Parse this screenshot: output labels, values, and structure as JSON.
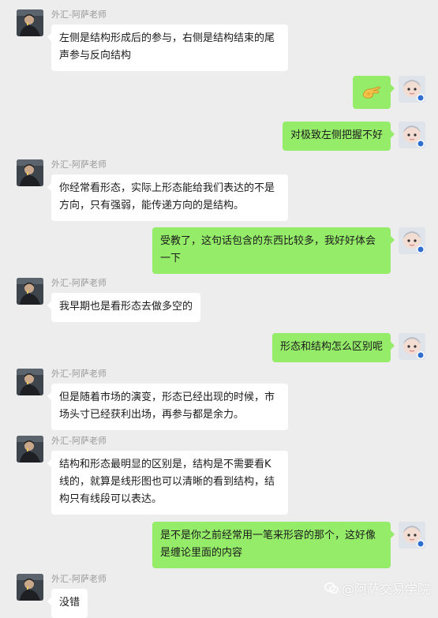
{
  "messages": [
    {
      "id": "m1",
      "side": "left",
      "sender": "外汇-阿萨老师",
      "text": "左侧是结构形成后的参与，右侧是结构结束的尾声参与反向结构"
    },
    {
      "id": "m2",
      "side": "right",
      "emoji": "ok-hand-emoji",
      "text": ""
    },
    {
      "id": "m3",
      "side": "right",
      "text": "对极致左侧把握不好"
    },
    {
      "id": "m4",
      "side": "left",
      "sender": "外汇-阿萨老师",
      "text": "你经常看形态，实际上形态能给我们表达的不是方向，只有强弱，能传递方向的是结构。"
    },
    {
      "id": "m5",
      "side": "right",
      "text": "受教了，这句话包含的东西比较多，我好好体会一下"
    },
    {
      "id": "m6",
      "side": "left",
      "sender": "外汇-阿萨老师",
      "text": "我早期也是看形态去做多空的"
    },
    {
      "id": "m7",
      "side": "right",
      "text": "形态和结构怎么区别呢"
    },
    {
      "id": "m8",
      "side": "left",
      "sender": "外汇-阿萨老师",
      "text": "但是随着市场的演变，形态已经出现的时候，市场头寸已经获利出场，再参与都是余力。"
    },
    {
      "id": "m9",
      "side": "left",
      "sender": "外汇-阿萨老师",
      "text": "结构和形态最明显的区别是，结构是不需要看K线的，就算是线形图也可以清晰的看到结构，结构只有线段可以表达。"
    },
    {
      "id": "m10",
      "side": "right",
      "text": "是不是你之前经常用一笔来形容的那个，这好像是缠论里面的内容"
    },
    {
      "id": "m11",
      "side": "left",
      "sender": "外汇-阿萨老师",
      "text": "没错"
    }
  ],
  "watermark": {
    "text": "@阿萨交易学院",
    "icon": "wechat-official-account-icon"
  },
  "colors": {
    "background": "#ededed",
    "left_bubble": "#ffffff",
    "right_bubble": "#95ec69",
    "sender": "#9a9a9a"
  }
}
